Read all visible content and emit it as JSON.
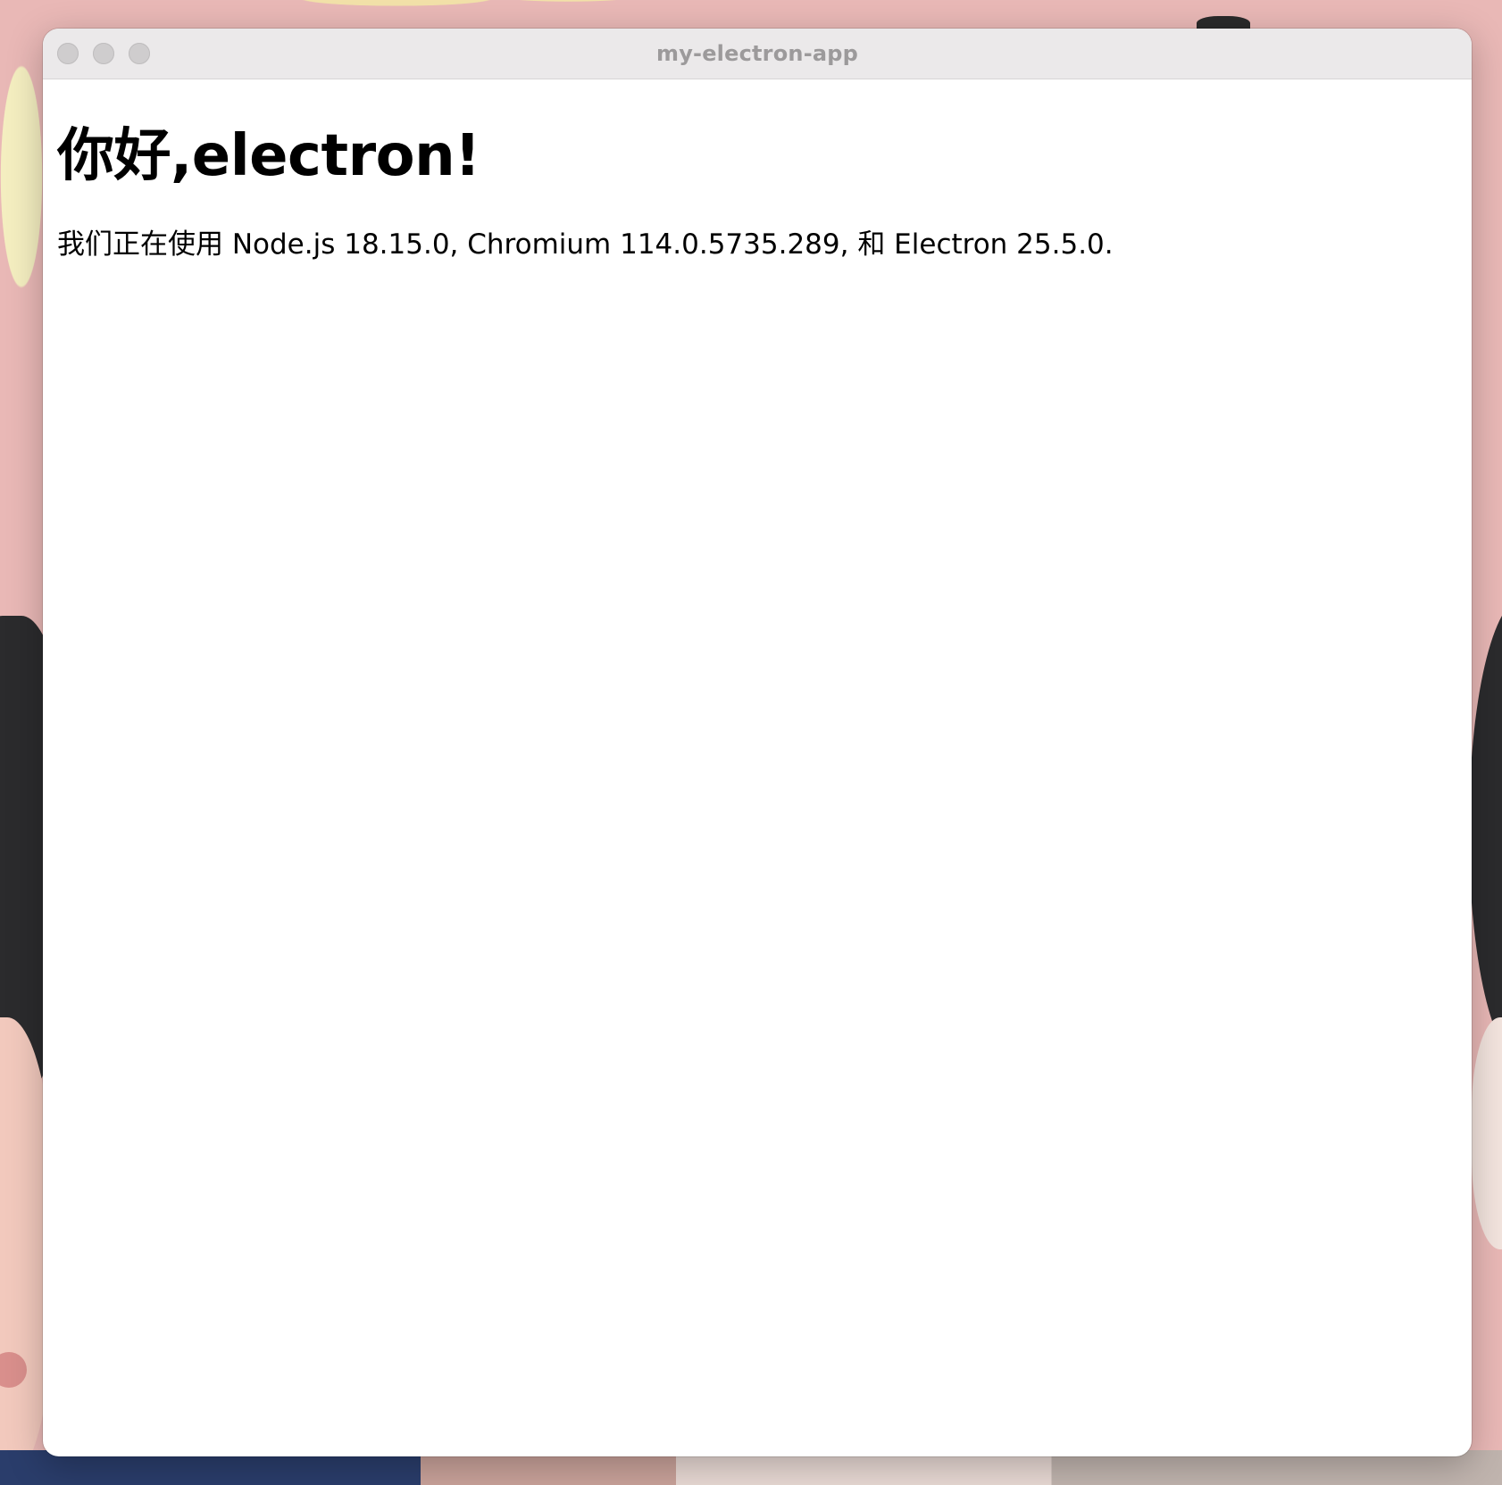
{
  "window": {
    "title": "my-electron-app"
  },
  "page": {
    "heading": "你好,electron!",
    "versions_text": "我们正在使用 Node.js 18.15.0, Chromium 114.0.5735.289, 和 Electron 25.5.0."
  },
  "colors": {
    "wallpaper": "#e9b8b6",
    "titlebar": "#ebe9ea",
    "title_text": "#9c9a9b",
    "traffic_light_inactive": "#cfcdce",
    "content_bg": "#ffffff",
    "text": "#000000"
  },
  "icons": {
    "traffic_lights": [
      "close-button",
      "minimize-button",
      "zoom-button"
    ]
  }
}
